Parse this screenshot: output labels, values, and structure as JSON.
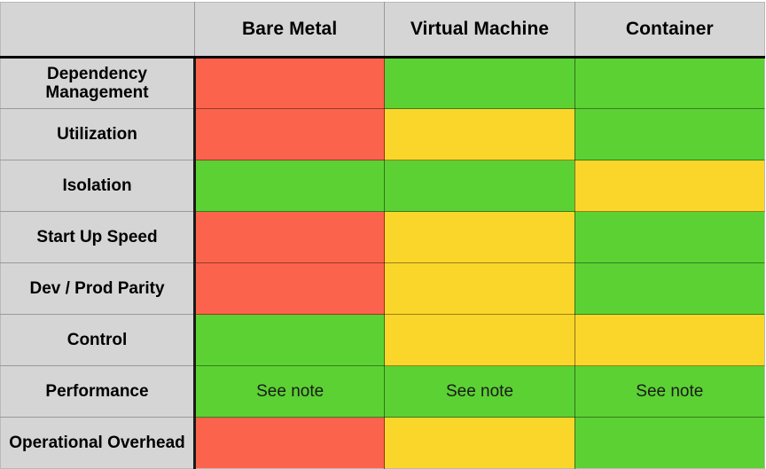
{
  "table": {
    "corner_label": "",
    "columns": [
      {
        "id": "bare-metal",
        "label": "Bare Metal"
      },
      {
        "id": "virtual-machine",
        "label": "Virtual Machine"
      },
      {
        "id": "container",
        "label": "Container"
      }
    ],
    "rows": [
      {
        "id": "dependency-management",
        "label": "Dependency Management",
        "cells": [
          {
            "status": "red",
            "text": ""
          },
          {
            "status": "green",
            "text": ""
          },
          {
            "status": "green",
            "text": ""
          }
        ]
      },
      {
        "id": "utilization",
        "label": "Utilization",
        "cells": [
          {
            "status": "red",
            "text": ""
          },
          {
            "status": "yellow",
            "text": ""
          },
          {
            "status": "green",
            "text": ""
          }
        ]
      },
      {
        "id": "isolation",
        "label": "Isolation",
        "cells": [
          {
            "status": "green",
            "text": ""
          },
          {
            "status": "green",
            "text": ""
          },
          {
            "status": "yellow",
            "text": ""
          }
        ]
      },
      {
        "id": "start-up-speed",
        "label": "Start Up Speed",
        "cells": [
          {
            "status": "red",
            "text": ""
          },
          {
            "status": "yellow",
            "text": ""
          },
          {
            "status": "green",
            "text": ""
          }
        ]
      },
      {
        "id": "dev-prod-parity",
        "label": "Dev / Prod Parity",
        "cells": [
          {
            "status": "red",
            "text": ""
          },
          {
            "status": "yellow",
            "text": ""
          },
          {
            "status": "green",
            "text": ""
          }
        ]
      },
      {
        "id": "control",
        "label": "Control",
        "cells": [
          {
            "status": "green",
            "text": ""
          },
          {
            "status": "yellow",
            "text": ""
          },
          {
            "status": "yellow",
            "text": ""
          }
        ]
      },
      {
        "id": "performance",
        "label": "Performance",
        "cells": [
          {
            "status": "green",
            "text": "See note"
          },
          {
            "status": "green",
            "text": "See note"
          },
          {
            "status": "green",
            "text": "See note"
          }
        ]
      },
      {
        "id": "operational-overhead",
        "label": "Operational Overhead",
        "cells": [
          {
            "status": "red",
            "text": ""
          },
          {
            "status": "yellow",
            "text": ""
          },
          {
            "status": "green",
            "text": ""
          }
        ]
      }
    ]
  },
  "colors": {
    "red": "#fb634c",
    "green": "#5cd133",
    "yellow": "#fbd62a",
    "header_background": "#d5d5d5",
    "label_background": "#d5d5d5",
    "grid_line": "#9a9a9a",
    "header_rule": "#000000",
    "text": "#000000",
    "page_background": "#ffffff"
  }
}
